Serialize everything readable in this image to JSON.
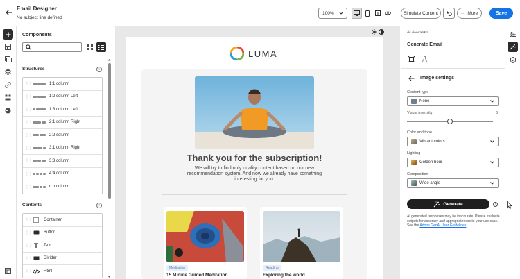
{
  "header": {
    "title": "Email Designer",
    "subtitle": "No subject line defined",
    "zoom": "100%",
    "simulate_label": "Simulate Content",
    "more_label": "More",
    "save_label": "Save"
  },
  "components": {
    "title": "Components",
    "search_placeholder": "",
    "structures_title": "Structures",
    "structures": [
      {
        "label": "1:1 column",
        "cols": [
          1
        ]
      },
      {
        "label": "1:2 column Left",
        "cols": [
          1,
          2
        ]
      },
      {
        "label": "1:3 column Left",
        "cols": [
          1,
          3
        ]
      },
      {
        "label": "2:1 column Right",
        "cols": [
          2,
          1
        ]
      },
      {
        "label": "2:2 column",
        "cols": [
          1,
          1
        ]
      },
      {
        "label": "3:1 column Right",
        "cols": [
          3,
          1
        ]
      },
      {
        "label": "3:3 column",
        "cols": [
          1,
          1,
          1
        ]
      },
      {
        "label": "4:4 column",
        "cols": [
          1,
          1,
          1,
          1
        ]
      },
      {
        "label": "n:n column",
        "cols": [
          2,
          1,
          1
        ]
      }
    ],
    "contents_title": "Contents",
    "contents": [
      {
        "label": "Container",
        "icon": "container-icon"
      },
      {
        "label": "Button",
        "icon": "button-icon"
      },
      {
        "label": "Text",
        "icon": "text-icon"
      },
      {
        "label": "Divider",
        "icon": "divider-icon"
      },
      {
        "label": "Html",
        "icon": "html-icon"
      }
    ]
  },
  "email": {
    "brand": "LUMA",
    "headline": "Thank you for the subscription!",
    "body": "We will try to find only quality content based on our new recommendation system. And now we already have something interesting for you:",
    "cards": [
      {
        "tag": "Meditation",
        "title": "15 Minute Guided Meditation"
      },
      {
        "tag": "Reading",
        "title": "Exploring the world"
      }
    ]
  },
  "ai": {
    "panel_title": "AI Assistant",
    "section_title": "Generate Email",
    "settings_title": "Image settings",
    "content_type_label": "Content type",
    "content_type_value": "None",
    "visual_intensity_label": "Visual intensity",
    "visual_intensity_value": "6",
    "visual_intensity_fraction": 0.5,
    "color_tone_label": "Color and tone",
    "color_tone_value": "Vibrant colors",
    "lighting_label": "Lighting",
    "lighting_value": "Golden hour",
    "composition_label": "Composition",
    "composition_value": "Wide angle",
    "generate_label": "Generate",
    "disclaimer": "AI generated responses may be inaccurate. Please evaluate outputs for accuracy and appropriateness to your use case. See the ",
    "disclaimer_link": "Adobe GenAI User Guidelines",
    "disclaimer_end": "."
  },
  "colors": {
    "accent": "#1473e6",
    "generate_bg": "#1f1f1f"
  }
}
